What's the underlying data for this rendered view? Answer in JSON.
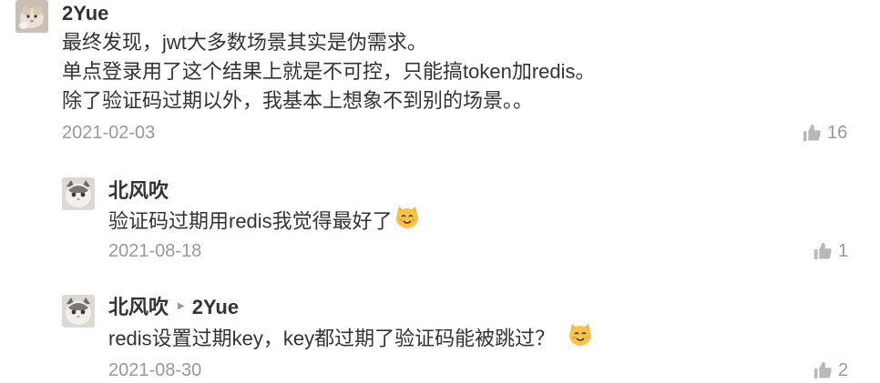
{
  "comments": [
    {
      "user": "2Yue",
      "lines": [
        "最终发现，jwt大多数场景其实是伪需求。",
        "单点登录用了这个结果上就是不可控，只能搞token加redis。",
        "除了验证码过期以外，我基本上想象不到别的场景。。"
      ],
      "date": "2021-02-03",
      "likes": "16",
      "avatar": "hamster-avatar"
    },
    {
      "user": "北风吹",
      "text": "验证码过期用redis我觉得最好了",
      "date": "2021-08-18",
      "likes": "1",
      "avatar": "cat-avatar"
    },
    {
      "user": "北风吹",
      "reply_to": "2Yue",
      "text": "redis设置过期key，key都过期了验证码能被跳过？",
      "date": "2021-08-30",
      "likes": "2",
      "avatar": "cat-avatar"
    }
  ],
  "icons": {
    "like": "thumbs-up-icon",
    "reply": "reply-arrow-icon",
    "emoji": "cat-face-emoji"
  },
  "colors": {
    "text": "#333333",
    "meta": "#999999",
    "like_icon": "#b8b8b8"
  }
}
